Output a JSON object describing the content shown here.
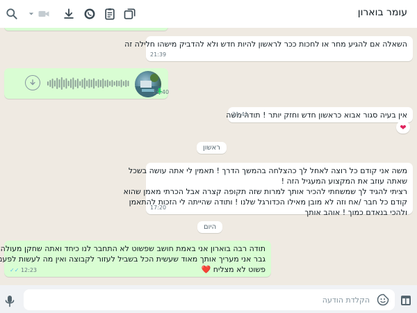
{
  "header": {
    "contact_name": "עומר בוארון"
  },
  "messages": [
    {
      "direction": "in",
      "lines": [
        "השאלה אם להגיע מחר או לחכות ככר לראשון להיות חדש ולא להדביק מישהו חלילה זה"
      ],
      "time": "21:39"
    },
    {
      "direction": "out",
      "type": "voice",
      "time": "21:40"
    },
    {
      "direction": "in",
      "lines": [
        "אין בעיה סגור אבוא כראשון חדש וחזק יותר ! תודה משה"
      ],
      "time": "21:41",
      "reaction": "❤"
    },
    {
      "direction": "in",
      "lines": [
        "משה אני קודם כל רוצה לאחל לך כהצלחה בהמשך הדרך ! תאמין לי אתה עושה בשכל",
        "שאתה עוזב את המקצוע המעגיל הזה !",
        "רציתי להגיד לך שמשחתי להכיר אותך למרות שזה תקופה קצרה אבל הכרתי מאמן שהוא",
        "קודם כל חבר /אח וזה לא מובן מאילו הכדורגל שלנו ! ותודה שהייתה לי הזכות להתאמן",
        "ולהכי בנאדם כמוך ! אוהב אותך"
      ],
      "time": "17:20"
    },
    {
      "direction": "out",
      "lines": [
        "תודה רבה בוארון אני באמת חושב שפשוט לא התחבר לנו כיחד ואתה שחקן מעולה ואחלה",
        "גבר אני מעריך אותך מאוד שעשית הכל בשביל לעזור לקבוצה ואין מה לעשות לפעמים זה",
        "פשוט לא מצליח ❤️"
      ],
      "time": "12:23"
    }
  ],
  "date_separators": [
    "ראשון",
    "היום"
  ],
  "composer": {
    "placeholder": "הקלדת הודעה"
  },
  "colors": {
    "outgoing_bubble": "#d9fdd3",
    "incoming_bubble": "#ffffff",
    "chat_background": "#efeae2",
    "read_ticks": "#53bdeb"
  },
  "icons": [
    "search-icon",
    "video-call-icon",
    "chevron-down-icon",
    "download-icon",
    "whatsapp-icon",
    "clipboard-icon",
    "new-window-icon",
    "sticker-icon",
    "mic-icon",
    "attach-panel-icon",
    "voice-download-icon"
  ]
}
